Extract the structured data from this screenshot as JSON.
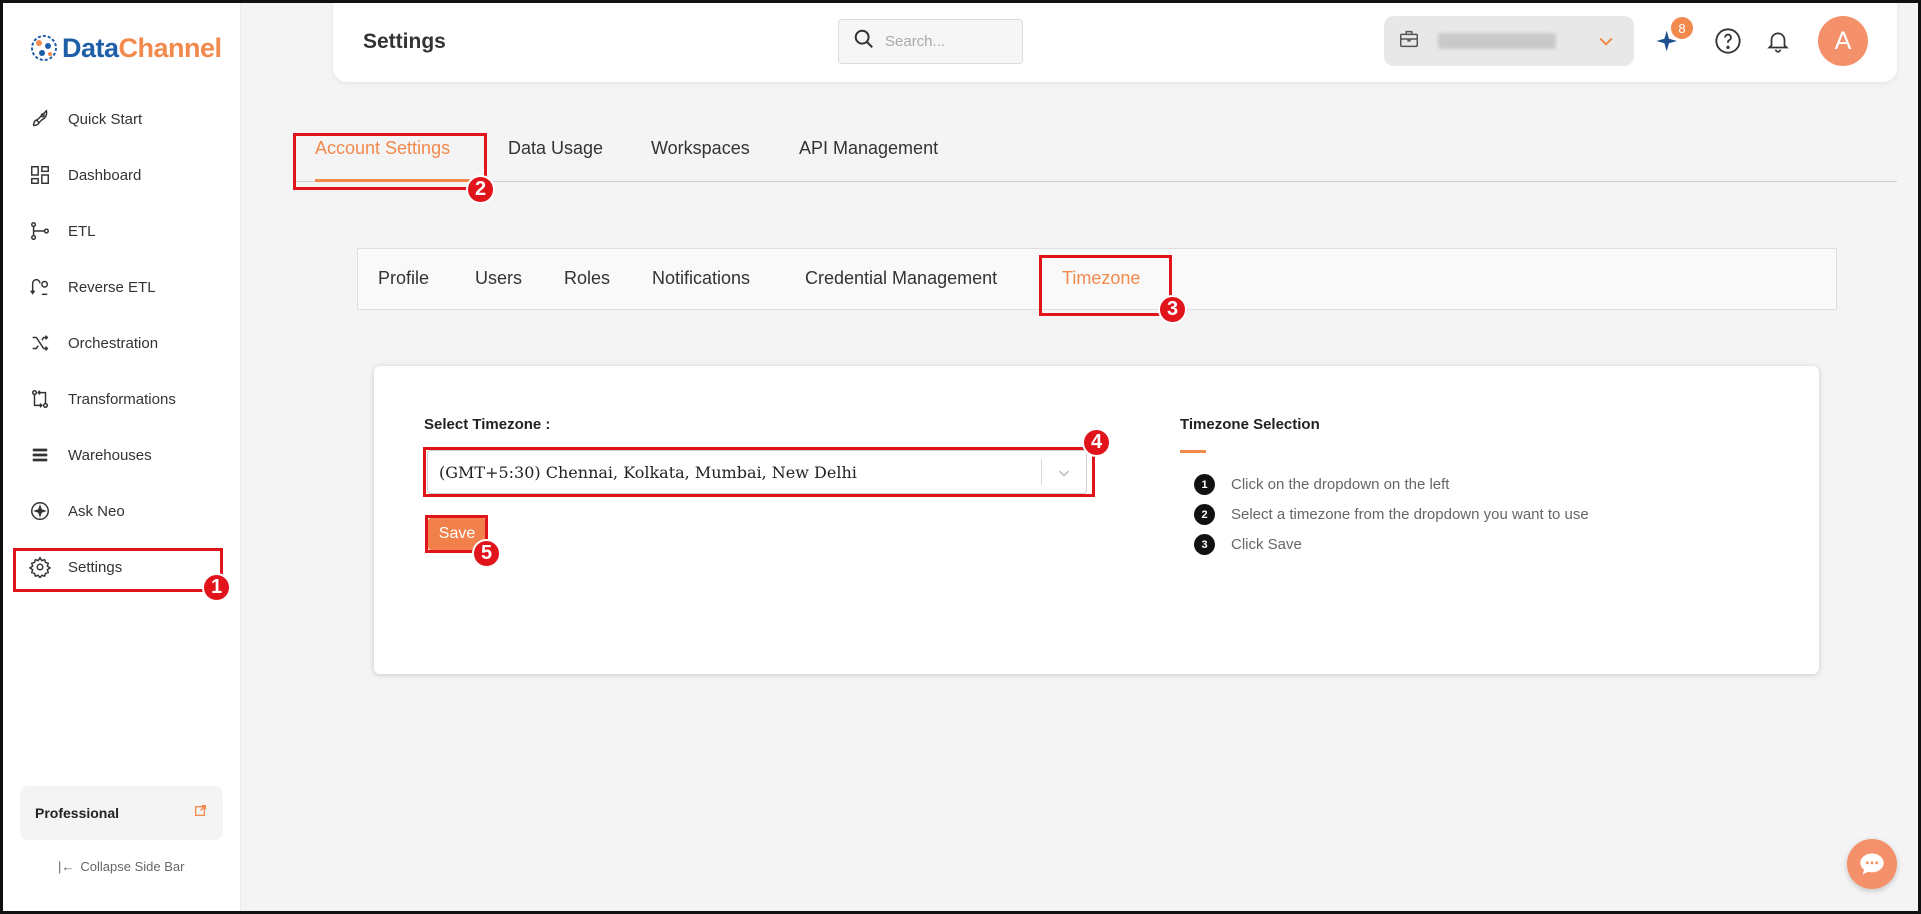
{
  "app": {
    "logo_part1": "Data",
    "logo_part2": "Channel",
    "page_title": "Settings"
  },
  "sidebar": {
    "items": [
      {
        "label": "Quick Start",
        "icon": "rocket-icon"
      },
      {
        "label": "Dashboard",
        "icon": "dashboard-icon"
      },
      {
        "label": "ETL",
        "icon": "etl-icon"
      },
      {
        "label": "Reverse ETL",
        "icon": "reverse-etl-icon"
      },
      {
        "label": "Orchestration",
        "icon": "orchestration-icon"
      },
      {
        "label": "Transformations",
        "icon": "transformations-icon"
      },
      {
        "label": "Warehouses",
        "icon": "warehouses-icon"
      },
      {
        "label": "Ask Neo",
        "icon": "ask-neo-icon"
      },
      {
        "label": "Settings",
        "icon": "gear-icon"
      }
    ],
    "plan": "Professional",
    "collapse_label": "Collapse Side Bar"
  },
  "topbar": {
    "search_placeholder": "Search...",
    "notification_badge": "8",
    "avatar_letter": "A"
  },
  "tabs_primary": [
    "Account Settings",
    "Data Usage",
    "Workspaces",
    "API Management"
  ],
  "tabs_primary_active": "Account Settings",
  "tabs_secondary": [
    "Profile",
    "Users",
    "Roles",
    "Notifications",
    "Credential Management",
    "Timezone"
  ],
  "tabs_secondary_active": "Timezone",
  "timezone": {
    "field_label": "Select Timezone :",
    "selected": "(GMT+5:30) Chennai, Kolkata, Mumbai, New Delhi",
    "save_label": "Save"
  },
  "info": {
    "title": "Timezone Selection",
    "steps": [
      {
        "num": "1",
        "text": "Click on the dropdown on the left"
      },
      {
        "num": "2",
        "text": "Select a timezone from the dropdown you want to use"
      },
      {
        "num": "3",
        "text": "Click Save"
      }
    ]
  },
  "annotations": [
    "1",
    "2",
    "3",
    "4",
    "5"
  ],
  "colors": {
    "accent": "#f2894d",
    "brand_blue": "#1f5fa8",
    "highlight": "#e0141a"
  }
}
